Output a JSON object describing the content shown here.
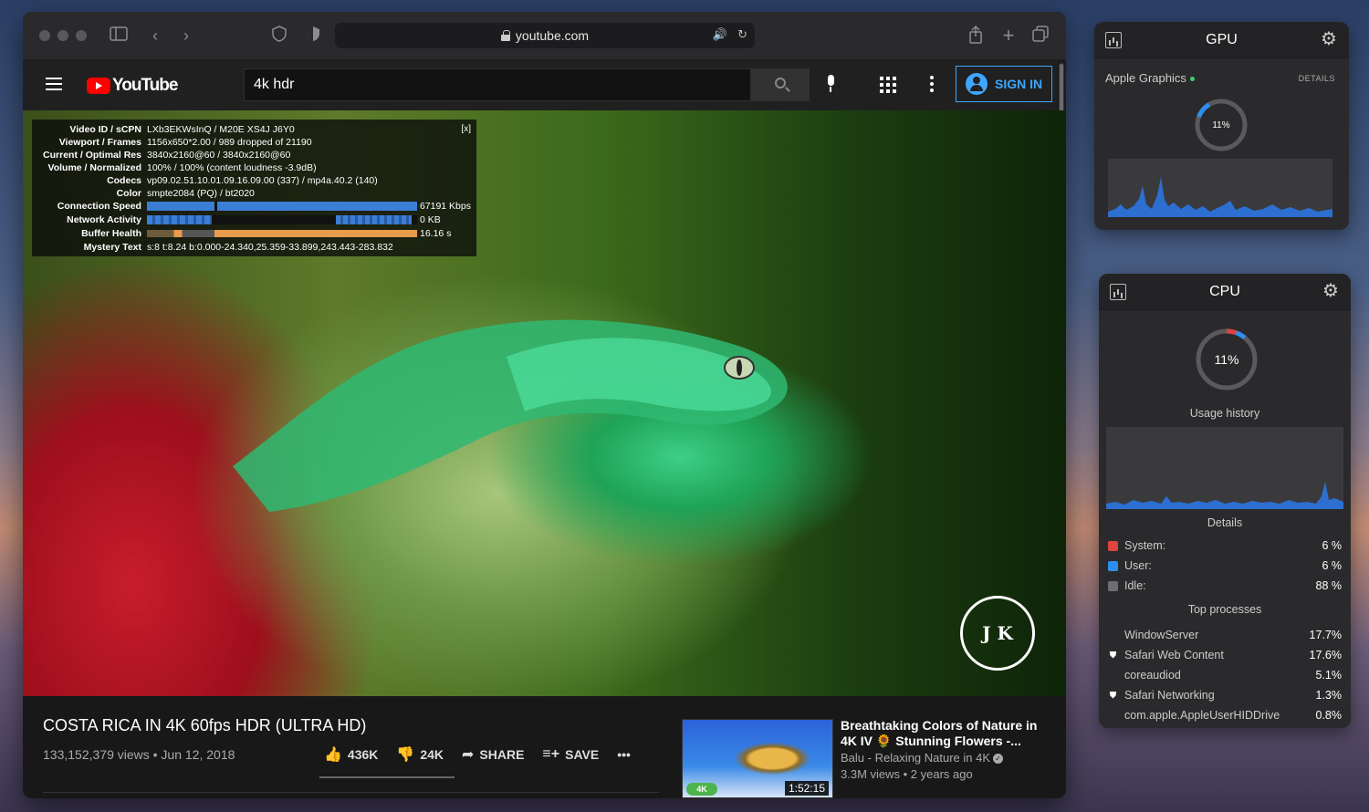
{
  "browser": {
    "url": "youtube.com"
  },
  "youtube": {
    "logo_text": "YouTube",
    "search_query": "4k hdr",
    "sign_in_label": "SIGN IN",
    "stats": {
      "close": "[x]",
      "rows": [
        {
          "label": "Video ID / sCPN",
          "value": "LXb3EKWsInQ / M20E XS4J J6Y0"
        },
        {
          "label": "Viewport / Frames",
          "value": "1156x650*2.00 / 989 dropped of 21190"
        },
        {
          "label": "Current / Optimal Res",
          "value": "3840x2160@60 / 3840x2160@60"
        },
        {
          "label": "Volume / Normalized",
          "value": "100% / 100% (content loudness -3.9dB)"
        },
        {
          "label": "Codecs",
          "value": "vp09.02.51.10.01.09.16.09.00 (337) / mp4a.40.2 (140)"
        },
        {
          "label": "Color",
          "value": "smpte2084 (PQ) / bt2020"
        },
        {
          "label": "Connection Speed",
          "value": "67191 Kbps"
        },
        {
          "label": "Network Activity",
          "value": "0 KB"
        },
        {
          "label": "Buffer Health",
          "value": "16.16 s"
        },
        {
          "label": "Mystery Text",
          "value": "s:8 t:8.24 b:0.000-24.340,25.359-33.899,243.443-283.832"
        }
      ]
    },
    "watermark": "J K",
    "video_title": "COSTA RICA IN 4K 60fps HDR (ULTRA HD)",
    "video_meta": "133,152,379 views • Jun 12, 2018",
    "actions": {
      "likes": "436K",
      "dislikes": "24K",
      "share": "SHARE",
      "save": "SAVE",
      "more": "•••"
    },
    "recommended": {
      "title": "Breathtaking Colors of Nature in 4K IV 🌻 Stunning Flowers -...",
      "channel": "Balu - Relaxing Nature in 4K",
      "views": "3.3M views • 2 years ago",
      "duration": "1:52:15",
      "badge": "4K"
    }
  },
  "gpu_widget": {
    "title": "GPU",
    "device": "Apple Graphics",
    "details_label": "DETAILS",
    "usage": "11%",
    "usage_fraction": 0.11
  },
  "cpu_widget": {
    "title": "CPU",
    "usage": "11%",
    "usage_fraction": 0.11,
    "usage_history_label": "Usage history",
    "details_label": "Details",
    "details": [
      {
        "name": "System:",
        "value": "6 %",
        "color": "#e0443e"
      },
      {
        "name": "User:",
        "value": "6 %",
        "color": "#2d8ef0"
      },
      {
        "name": "Idle:",
        "value": "88 %",
        "color": "#6e6e70"
      }
    ],
    "top_processes_label": "Top processes",
    "processes": [
      {
        "name": "WindowServer",
        "value": "17.7%",
        "icon": ""
      },
      {
        "name": "Safari Web Content",
        "value": "17.6%",
        "icon": "shield-icon"
      },
      {
        "name": "coreaudiod",
        "value": "5.1%",
        "icon": ""
      },
      {
        "name": "Safari Networking",
        "value": "1.3%",
        "icon": "shield-icon"
      },
      {
        "name": "com.apple.AppleUserHIDDrive",
        "value": "0.8%",
        "icon": ""
      }
    ]
  }
}
